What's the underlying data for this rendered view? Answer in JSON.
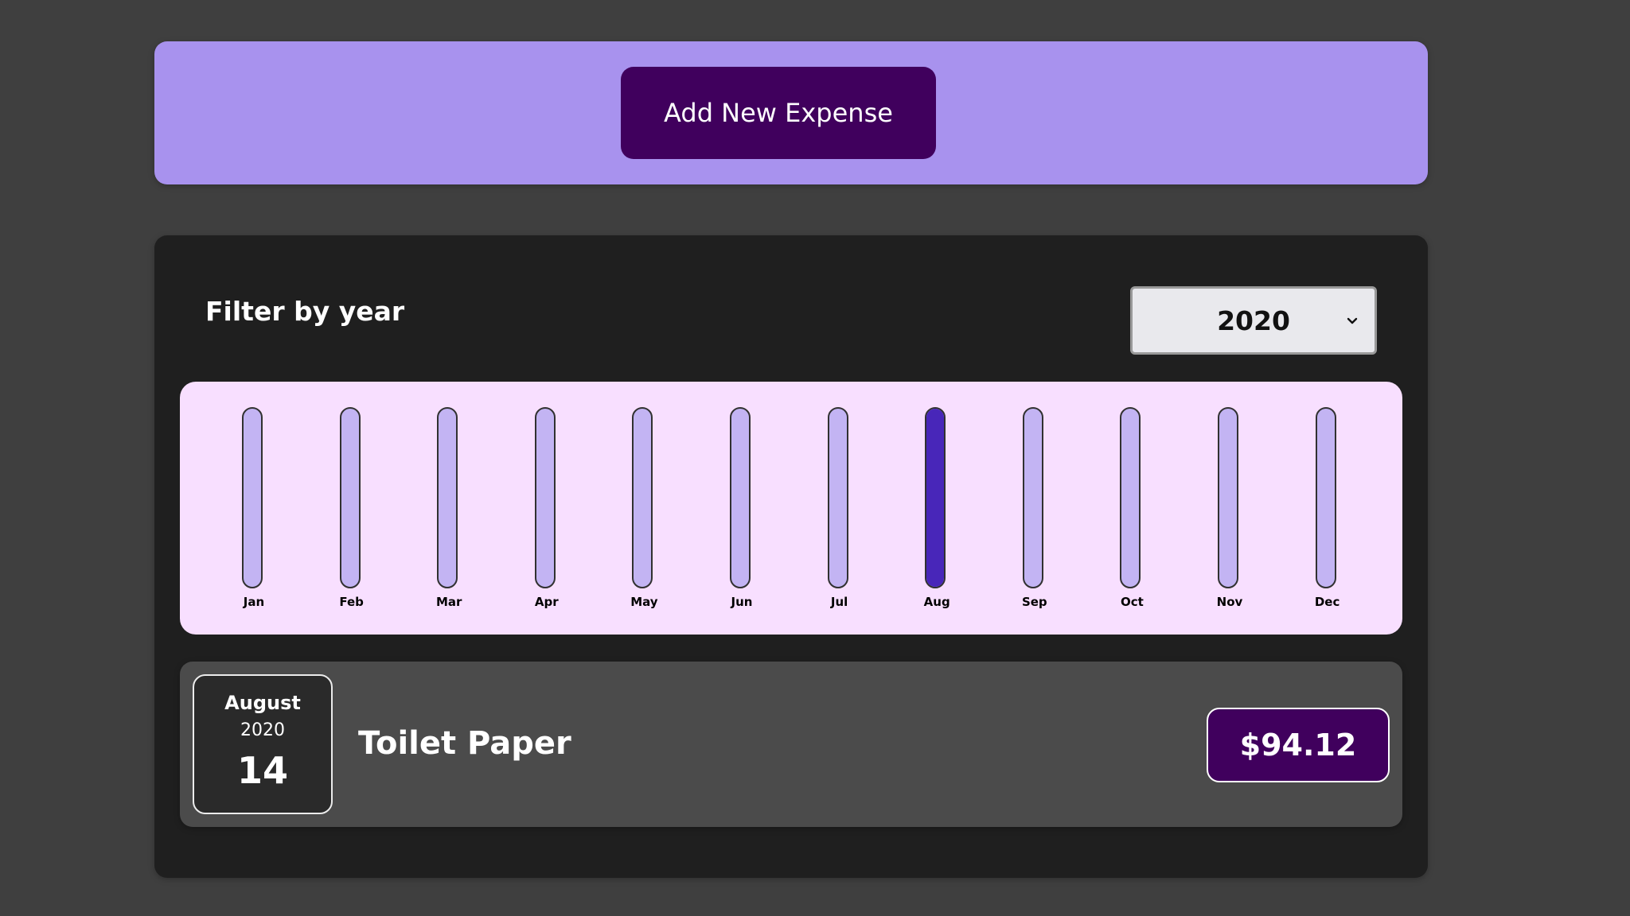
{
  "new_expense": {
    "add_button_label": "Add New Expense"
  },
  "filter": {
    "label": "Filter by year",
    "selected_year": "2020",
    "chevron_icon": "chevron-down-icon"
  },
  "chart_data": {
    "type": "bar",
    "categories": [
      "Jan",
      "Feb",
      "Mar",
      "Apr",
      "May",
      "Jun",
      "Jul",
      "Aug",
      "Sep",
      "Oct",
      "Nov",
      "Dec"
    ],
    "values": [
      0,
      0,
      0,
      0,
      0,
      0,
      0,
      94.12,
      0,
      0,
      0,
      0
    ],
    "ylim": [
      0,
      94.12
    ],
    "colors": {
      "track": "#c3b4f3",
      "fill": "#4826b9",
      "background": "#f8dfff"
    }
  },
  "expenses": [
    {
      "month": "August",
      "year": "2020",
      "day": "14",
      "title": "Toilet Paper",
      "amount": "$94.12"
    }
  ],
  "colors": {
    "page_background": "#3f3f3f",
    "new_expense_panel": "#a892ee",
    "accent_dark": "#40005d",
    "expenses_panel": "#1f1f1f",
    "expense_item": "#4b4b4b"
  }
}
